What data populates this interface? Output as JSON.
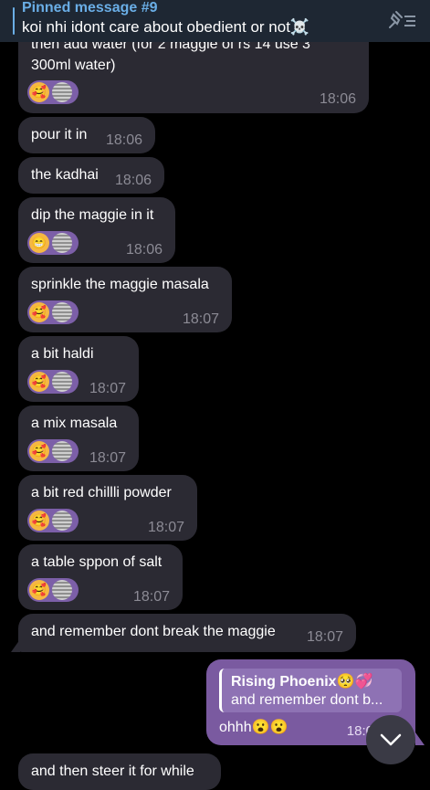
{
  "pinned": {
    "title": "Pinned message #9",
    "text": "koi nhi idont care about obedient or not☠️"
  },
  "messages": [
    {
      "text": "then add water (for 2 maggie of rs 14 use 3",
      "text2": "300ml water)",
      "time": "18:06",
      "reaction": "🥰"
    },
    {
      "text": "pour it in",
      "time": "18:06"
    },
    {
      "text": "the kadhai",
      "time": "18:06"
    },
    {
      "text": "dip the maggie in it",
      "time": "18:06",
      "reaction": "😁"
    },
    {
      "text": "sprinkle the maggie masala",
      "time": "18:07",
      "reaction": "🥰"
    },
    {
      "text": "a bit haldi",
      "time": "18:07",
      "reaction": "🥰"
    },
    {
      "text": "a mix masala",
      "time": "18:07",
      "reaction": "🥰"
    },
    {
      "text": "a bit red chillli powder",
      "time": "18:07",
      "reaction": "🥰"
    },
    {
      "text": "a table sppon of salt",
      "time": "18:07",
      "reaction": "🥰"
    },
    {
      "text": "and remember dont break the maggie",
      "time": "18:07"
    },
    {
      "text": "and then steer it for while"
    }
  ],
  "outgoing": {
    "reply_name": "Rising Phoenix🥺💞",
    "reply_text": "and remember dont b...",
    "text": "ohhh😮😮",
    "time": "18:0"
  },
  "icons": {
    "pin": "unpin-icon",
    "scroll": "chevron-down-icon"
  },
  "colors": {
    "background": "#000000",
    "incoming_bubble": "#2b2a33",
    "outgoing_bubble": "#7a5aa0",
    "reaction_pill": "#7c5fa8",
    "pinned_accent": "#6aaee6"
  }
}
